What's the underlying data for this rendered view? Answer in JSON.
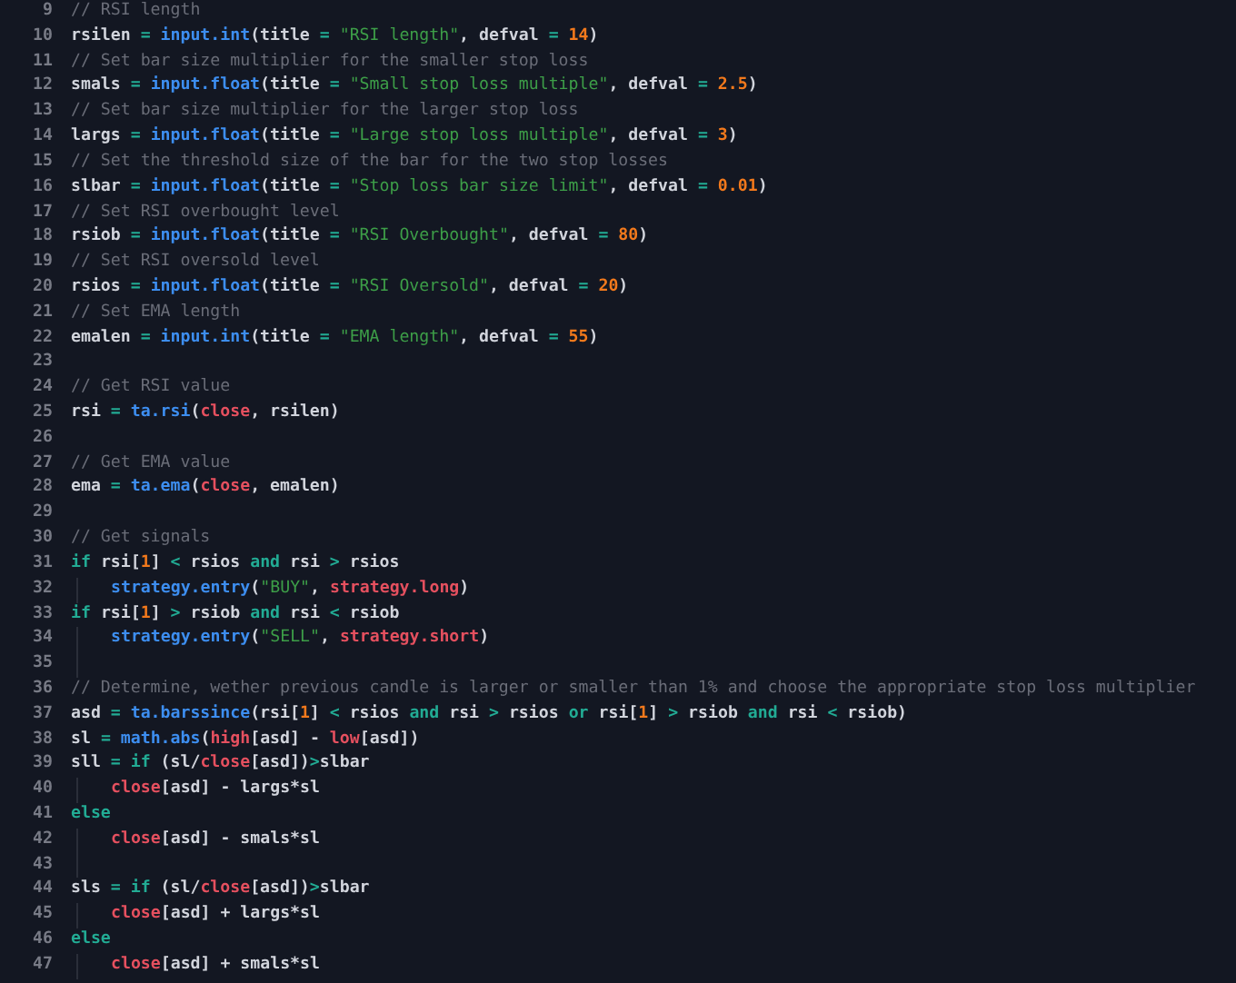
{
  "editor": {
    "lines": [
      {
        "number": "9",
        "tokens": [
          {
            "kind": "comment",
            "text": "// RSI length"
          }
        ]
      },
      {
        "number": "10",
        "tokens": [
          {
            "kind": "plain",
            "text": "rsilen "
          },
          {
            "kind": "op",
            "text": "= "
          },
          {
            "kind": "func",
            "text": "input.int"
          },
          {
            "kind": "plain",
            "text": "(title "
          },
          {
            "kind": "op",
            "text": "= "
          },
          {
            "kind": "string",
            "text": "\"RSI length\""
          },
          {
            "kind": "plain",
            "text": ", defval "
          },
          {
            "kind": "op",
            "text": "= "
          },
          {
            "kind": "number",
            "text": "14"
          },
          {
            "kind": "plain",
            "text": ")"
          }
        ]
      },
      {
        "number": "11",
        "tokens": [
          {
            "kind": "comment",
            "text": "// Set bar size multiplier for the smaller stop loss"
          }
        ]
      },
      {
        "number": "12",
        "tokens": [
          {
            "kind": "plain",
            "text": "smals "
          },
          {
            "kind": "op",
            "text": "= "
          },
          {
            "kind": "func",
            "text": "input.float"
          },
          {
            "kind": "plain",
            "text": "(title "
          },
          {
            "kind": "op",
            "text": "= "
          },
          {
            "kind": "string",
            "text": "\"Small stop loss multiple\""
          },
          {
            "kind": "plain",
            "text": ", defval "
          },
          {
            "kind": "op",
            "text": "= "
          },
          {
            "kind": "number",
            "text": "2.5"
          },
          {
            "kind": "plain",
            "text": ")"
          }
        ]
      },
      {
        "number": "13",
        "tokens": [
          {
            "kind": "comment",
            "text": "// Set bar size multiplier for the larger stop loss"
          }
        ]
      },
      {
        "number": "14",
        "tokens": [
          {
            "kind": "plain",
            "text": "largs "
          },
          {
            "kind": "op",
            "text": "= "
          },
          {
            "kind": "func",
            "text": "input.float"
          },
          {
            "kind": "plain",
            "text": "(title "
          },
          {
            "kind": "op",
            "text": "= "
          },
          {
            "kind": "string",
            "text": "\"Large stop loss multiple\""
          },
          {
            "kind": "plain",
            "text": ", defval "
          },
          {
            "kind": "op",
            "text": "= "
          },
          {
            "kind": "number",
            "text": "3"
          },
          {
            "kind": "plain",
            "text": ")"
          }
        ]
      },
      {
        "number": "15",
        "tokens": [
          {
            "kind": "comment",
            "text": "// Set the threshold size of the bar for the two stop losses"
          }
        ]
      },
      {
        "number": "16",
        "tokens": [
          {
            "kind": "plain",
            "text": "slbar "
          },
          {
            "kind": "op",
            "text": "= "
          },
          {
            "kind": "func",
            "text": "input.float"
          },
          {
            "kind": "plain",
            "text": "(title "
          },
          {
            "kind": "op",
            "text": "= "
          },
          {
            "kind": "string",
            "text": "\"Stop loss bar size limit\""
          },
          {
            "kind": "plain",
            "text": ", defval "
          },
          {
            "kind": "op",
            "text": "= "
          },
          {
            "kind": "number",
            "text": "0.01"
          },
          {
            "kind": "plain",
            "text": ")"
          }
        ]
      },
      {
        "number": "17",
        "tokens": [
          {
            "kind": "comment",
            "text": "// Set RSI overbought level"
          }
        ]
      },
      {
        "number": "18",
        "tokens": [
          {
            "kind": "plain",
            "text": "rsiob "
          },
          {
            "kind": "op",
            "text": "= "
          },
          {
            "kind": "func",
            "text": "input.float"
          },
          {
            "kind": "plain",
            "text": "(title "
          },
          {
            "kind": "op",
            "text": "= "
          },
          {
            "kind": "string",
            "text": "\"RSI Overbought\""
          },
          {
            "kind": "plain",
            "text": ", defval "
          },
          {
            "kind": "op",
            "text": "= "
          },
          {
            "kind": "number",
            "text": "80"
          },
          {
            "kind": "plain",
            "text": ")"
          }
        ]
      },
      {
        "number": "19",
        "tokens": [
          {
            "kind": "comment",
            "text": "// Set RSI oversold level"
          }
        ]
      },
      {
        "number": "20",
        "tokens": [
          {
            "kind": "plain",
            "text": "rsios "
          },
          {
            "kind": "op",
            "text": "= "
          },
          {
            "kind": "func",
            "text": "input.float"
          },
          {
            "kind": "plain",
            "text": "(title "
          },
          {
            "kind": "op",
            "text": "= "
          },
          {
            "kind": "string",
            "text": "\"RSI Oversold\""
          },
          {
            "kind": "plain",
            "text": ", defval "
          },
          {
            "kind": "op",
            "text": "= "
          },
          {
            "kind": "number",
            "text": "20"
          },
          {
            "kind": "plain",
            "text": ")"
          }
        ]
      },
      {
        "number": "21",
        "tokens": [
          {
            "kind": "comment",
            "text": "// Set EMA length"
          }
        ]
      },
      {
        "number": "22",
        "tokens": [
          {
            "kind": "plain",
            "text": "emalen "
          },
          {
            "kind": "op",
            "text": "= "
          },
          {
            "kind": "func",
            "text": "input.int"
          },
          {
            "kind": "plain",
            "text": "(title "
          },
          {
            "kind": "op",
            "text": "= "
          },
          {
            "kind": "string",
            "text": "\"EMA length\""
          },
          {
            "kind": "plain",
            "text": ", defval "
          },
          {
            "kind": "op",
            "text": "= "
          },
          {
            "kind": "number",
            "text": "55"
          },
          {
            "kind": "plain",
            "text": ")"
          }
        ]
      },
      {
        "number": "23"
      },
      {
        "number": "24",
        "tokens": [
          {
            "kind": "comment",
            "text": "// Get RSI value"
          }
        ]
      },
      {
        "number": "25",
        "tokens": [
          {
            "kind": "plain",
            "text": "rsi "
          },
          {
            "kind": "op",
            "text": "= "
          },
          {
            "kind": "func",
            "text": "ta.rsi"
          },
          {
            "kind": "plain",
            "text": "("
          },
          {
            "kind": "var",
            "text": "close"
          },
          {
            "kind": "plain",
            "text": ", rsilen)"
          }
        ]
      },
      {
        "number": "26"
      },
      {
        "number": "27",
        "tokens": [
          {
            "kind": "comment",
            "text": "// Get EMA value"
          }
        ]
      },
      {
        "number": "28",
        "tokens": [
          {
            "kind": "plain",
            "text": "ema "
          },
          {
            "kind": "op",
            "text": "= "
          },
          {
            "kind": "func",
            "text": "ta.ema"
          },
          {
            "kind": "plain",
            "text": "("
          },
          {
            "kind": "var",
            "text": "close"
          },
          {
            "kind": "plain",
            "text": ", emalen)"
          }
        ]
      },
      {
        "number": "29"
      },
      {
        "number": "30",
        "tokens": [
          {
            "kind": "comment",
            "text": "// Get signals"
          }
        ]
      },
      {
        "number": "31",
        "tokens": [
          {
            "kind": "op",
            "text": "if "
          },
          {
            "kind": "plain",
            "text": "rsi["
          },
          {
            "kind": "number",
            "text": "1"
          },
          {
            "kind": "plain",
            "text": "] "
          },
          {
            "kind": "op",
            "text": "< "
          },
          {
            "kind": "plain",
            "text": "rsios "
          },
          {
            "kind": "op",
            "text": "and "
          },
          {
            "kind": "plain",
            "text": "rsi "
          },
          {
            "kind": "op",
            "text": "> "
          },
          {
            "kind": "plain",
            "text": "rsios"
          }
        ]
      },
      {
        "number": "32",
        "guide": true,
        "tokens": [
          {
            "kind": "func",
            "text": "strategy.entry"
          },
          {
            "kind": "plain",
            "text": "("
          },
          {
            "kind": "string",
            "text": "\"BUY\""
          },
          {
            "kind": "plain",
            "text": ", "
          },
          {
            "kind": "var",
            "text": "strategy.long"
          },
          {
            "kind": "plain",
            "text": ")"
          }
        ]
      },
      {
        "number": "33",
        "tokens": [
          {
            "kind": "op",
            "text": "if "
          },
          {
            "kind": "plain",
            "text": "rsi["
          },
          {
            "kind": "number",
            "text": "1"
          },
          {
            "kind": "plain",
            "text": "] "
          },
          {
            "kind": "op",
            "text": "> "
          },
          {
            "kind": "plain",
            "text": "rsiob "
          },
          {
            "kind": "op",
            "text": "and "
          },
          {
            "kind": "plain",
            "text": "rsi "
          },
          {
            "kind": "op",
            "text": "< "
          },
          {
            "kind": "plain",
            "text": "rsiob"
          }
        ]
      },
      {
        "number": "34",
        "guide": true,
        "tokens": [
          {
            "kind": "func",
            "text": "strategy.entry"
          },
          {
            "kind": "plain",
            "text": "("
          },
          {
            "kind": "string",
            "text": "\"SELL\""
          },
          {
            "kind": "plain",
            "text": ", "
          },
          {
            "kind": "var",
            "text": "strategy.short"
          },
          {
            "kind": "plain",
            "text": ")"
          }
        ]
      },
      {
        "number": "35",
        "guide": true
      },
      {
        "number": "36",
        "tokens": [
          {
            "kind": "comment",
            "text": "// Determine, wether previous candle is larger or smaller than 1% and choose the appropriate stop loss multiplier"
          }
        ]
      },
      {
        "number": "37",
        "tokens": [
          {
            "kind": "plain",
            "text": "asd "
          },
          {
            "kind": "op",
            "text": "= "
          },
          {
            "kind": "func",
            "text": "ta.barssince"
          },
          {
            "kind": "plain",
            "text": "(rsi["
          },
          {
            "kind": "number",
            "text": "1"
          },
          {
            "kind": "plain",
            "text": "] "
          },
          {
            "kind": "op",
            "text": "< "
          },
          {
            "kind": "plain",
            "text": "rsios "
          },
          {
            "kind": "op",
            "text": "and "
          },
          {
            "kind": "plain",
            "text": "rsi "
          },
          {
            "kind": "op",
            "text": "> "
          },
          {
            "kind": "plain",
            "text": "rsios "
          },
          {
            "kind": "op",
            "text": "or "
          },
          {
            "kind": "plain",
            "text": "rsi["
          },
          {
            "kind": "number",
            "text": "1"
          },
          {
            "kind": "plain",
            "text": "] "
          },
          {
            "kind": "op",
            "text": "> "
          },
          {
            "kind": "plain",
            "text": "rsiob "
          },
          {
            "kind": "op",
            "text": "and "
          },
          {
            "kind": "plain",
            "text": "rsi "
          },
          {
            "kind": "op",
            "text": "< "
          },
          {
            "kind": "plain",
            "text": "rsiob)"
          }
        ]
      },
      {
        "number": "38",
        "tokens": [
          {
            "kind": "plain",
            "text": "sl "
          },
          {
            "kind": "op",
            "text": "= "
          },
          {
            "kind": "func",
            "text": "math.abs"
          },
          {
            "kind": "plain",
            "text": "("
          },
          {
            "kind": "var",
            "text": "high"
          },
          {
            "kind": "plain",
            "text": "[asd] - "
          },
          {
            "kind": "var",
            "text": "low"
          },
          {
            "kind": "plain",
            "text": "[asd])"
          }
        ]
      },
      {
        "number": "39",
        "tokens": [
          {
            "kind": "plain",
            "text": "sll "
          },
          {
            "kind": "op",
            "text": "= if "
          },
          {
            "kind": "plain",
            "text": "(sl/"
          },
          {
            "kind": "var",
            "text": "close"
          },
          {
            "kind": "plain",
            "text": "[asd])"
          },
          {
            "kind": "op",
            "text": ">"
          },
          {
            "kind": "plain",
            "text": "slbar"
          }
        ]
      },
      {
        "number": "40",
        "guide": true,
        "tokens": [
          {
            "kind": "var",
            "text": "close"
          },
          {
            "kind": "plain",
            "text": "[asd] - largs*sl"
          }
        ]
      },
      {
        "number": "41",
        "tokens": [
          {
            "kind": "op",
            "text": "else"
          }
        ]
      },
      {
        "number": "42",
        "guide": true,
        "tokens": [
          {
            "kind": "var",
            "text": "close"
          },
          {
            "kind": "plain",
            "text": "[asd] - smals*sl"
          }
        ]
      },
      {
        "number": "43",
        "guide": true
      },
      {
        "number": "44",
        "tokens": [
          {
            "kind": "plain",
            "text": "sls "
          },
          {
            "kind": "op",
            "text": "= if "
          },
          {
            "kind": "plain",
            "text": "(sl/"
          },
          {
            "kind": "var",
            "text": "close"
          },
          {
            "kind": "plain",
            "text": "[asd])"
          },
          {
            "kind": "op",
            "text": ">"
          },
          {
            "kind": "plain",
            "text": "slbar"
          }
        ]
      },
      {
        "number": "45",
        "guide": true,
        "tokens": [
          {
            "kind": "var",
            "text": "close"
          },
          {
            "kind": "plain",
            "text": "[asd] + largs*sl"
          }
        ]
      },
      {
        "number": "46",
        "tokens": [
          {
            "kind": "op",
            "text": "else"
          }
        ]
      },
      {
        "number": "47",
        "guide": true,
        "tokens": [
          {
            "kind": "var",
            "text": "close"
          },
          {
            "kind": "plain",
            "text": "[asd] + smals*sl"
          }
        ]
      }
    ]
  }
}
